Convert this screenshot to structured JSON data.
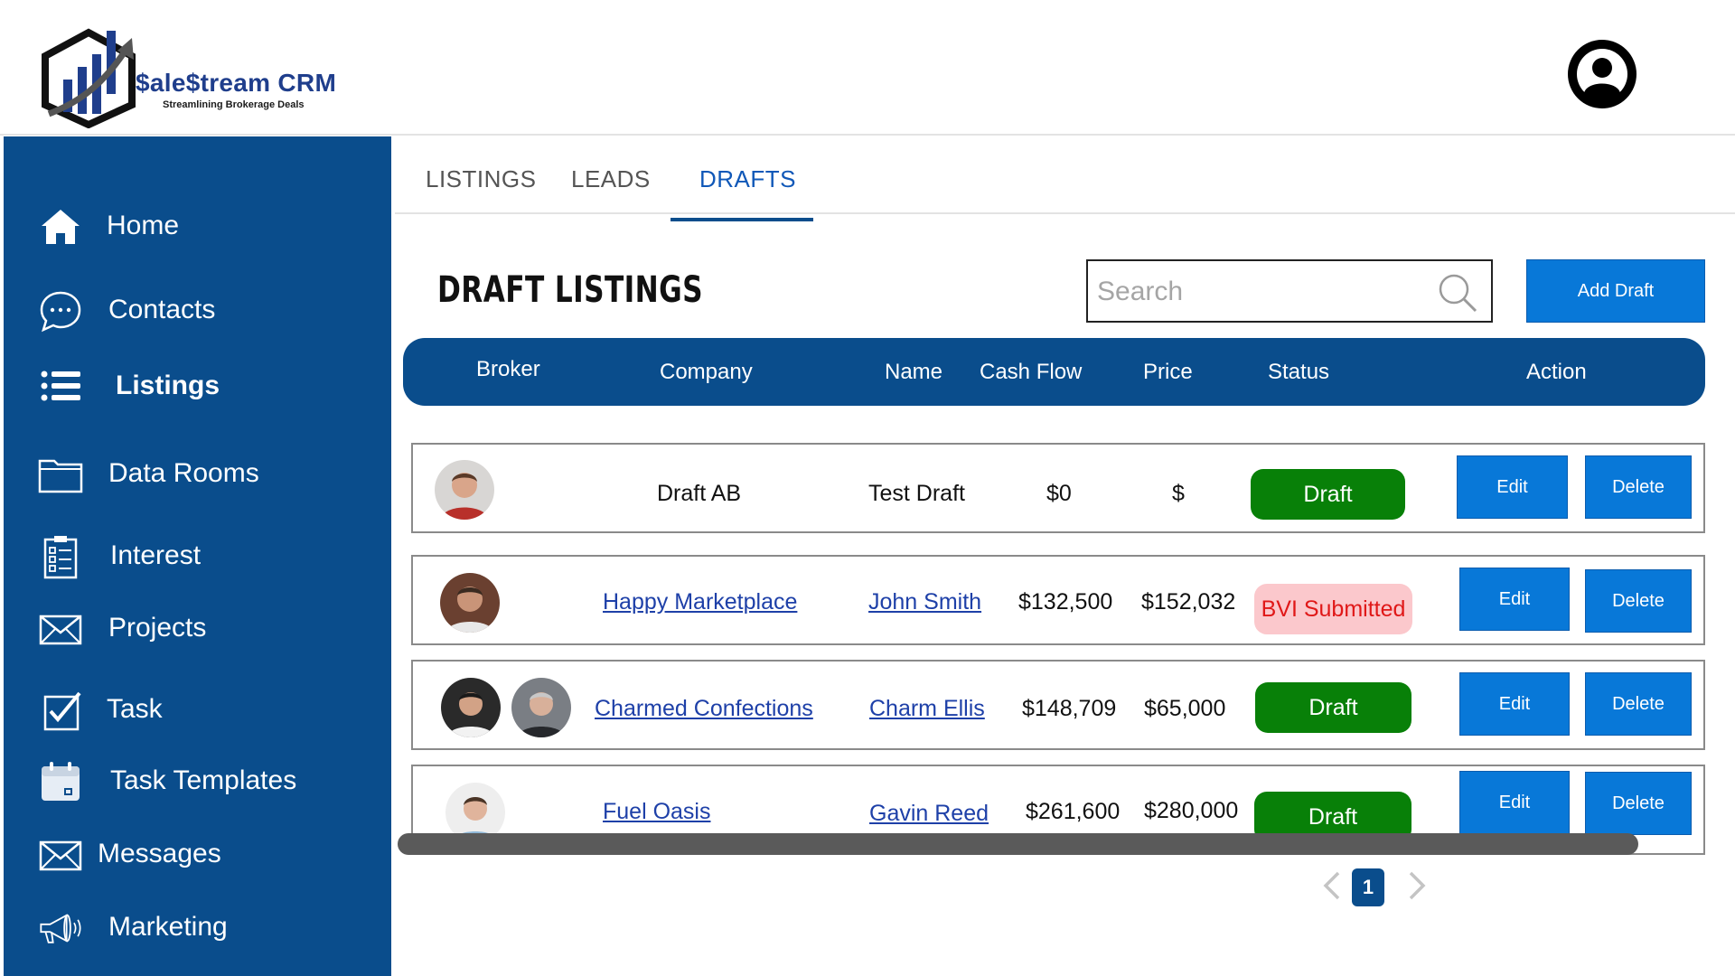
{
  "app": {
    "logo_name": "$ale$tream CRM",
    "logo_tagline": "Streamlining Brokerage Deals",
    "brand_color": "#0a4d8c",
    "accent_color": "#0878d8"
  },
  "sidebar": {
    "items": [
      {
        "label": "Home",
        "icon": "home-icon"
      },
      {
        "label": "Contacts",
        "icon": "chat-bubble-icon"
      },
      {
        "label": "Listings",
        "icon": "list-icon",
        "active": true
      },
      {
        "label": "Data Rooms",
        "icon": "folder-icon"
      },
      {
        "label": "Interest",
        "icon": "clipboard-checklist-icon"
      },
      {
        "label": "Projects",
        "icon": "envelope-icon"
      },
      {
        "label": "Task",
        "icon": "checkbox-icon"
      },
      {
        "label": "Task Templates",
        "icon": "calendar-icon"
      },
      {
        "label": "Messages",
        "icon": "envelope-icon"
      },
      {
        "label": "Marketing",
        "icon": "megaphone-icon"
      }
    ]
  },
  "tabs": [
    {
      "label": "LISTINGS"
    },
    {
      "label": "LEADS"
    },
    {
      "label": "DRAFTS",
      "active": true
    }
  ],
  "toolbar": {
    "title": "DRAFT LISTINGS",
    "search_placeholder": "Search",
    "add_label": "Add Draft"
  },
  "table": {
    "columns": [
      "Broker",
      "Company",
      "Name",
      "Cash Flow",
      "Price",
      "Status",
      "Action"
    ],
    "rows": [
      {
        "brokers": 1,
        "company": "Draft AB",
        "company_link": false,
        "name": "Test Draft",
        "name_link": false,
        "cash_flow": "$0",
        "price": "$",
        "status": "Draft",
        "status_type": "draft"
      },
      {
        "brokers": 1,
        "company": "Happy Marketplace",
        "company_link": true,
        "name": "John Smith",
        "name_link": true,
        "cash_flow": "$132,500",
        "price": "$152,032",
        "status": "BVI Submitted",
        "status_type": "bvi"
      },
      {
        "brokers": 2,
        "company": "Charmed Confections",
        "company_link": true,
        "name": "Charm Ellis",
        "name_link": true,
        "cash_flow": "$148,709",
        "price": "$65,000",
        "status": "Draft",
        "status_type": "draft"
      },
      {
        "brokers": 1,
        "company": "Fuel Oasis",
        "company_link": true,
        "name": "Gavin Reed",
        "name_link": true,
        "cash_flow": "$261,600",
        "price": "$280,000",
        "status": "Draft",
        "status_type": "draft"
      }
    ],
    "edit_label": "Edit",
    "delete_label": "Delete"
  },
  "pagination": {
    "current_page": "1"
  }
}
